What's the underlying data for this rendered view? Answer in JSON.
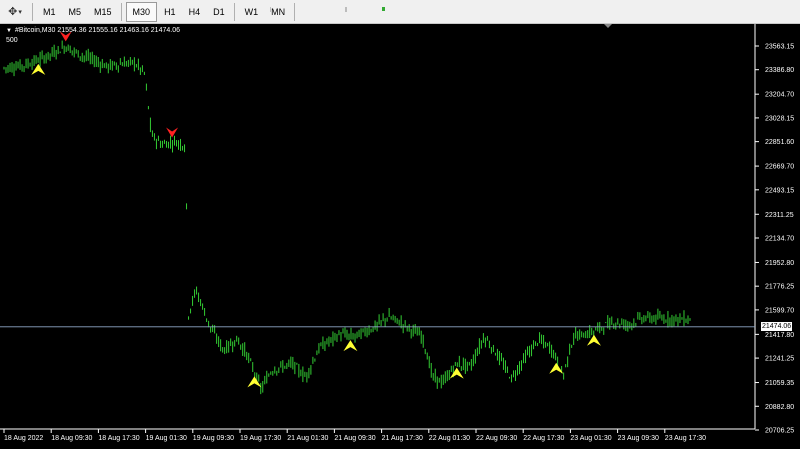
{
  "toolbar": {
    "timeframes": [
      {
        "label": "M1",
        "active": false
      },
      {
        "label": "M5",
        "active": false
      },
      {
        "label": "M15",
        "active": false
      },
      {
        "label": "M30",
        "active": true
      },
      {
        "label": "H1",
        "active": false
      },
      {
        "label": "H4",
        "active": false
      },
      {
        "label": "D1",
        "active": false
      },
      {
        "label": "W1",
        "active": false
      },
      {
        "label": "MN",
        "active": false
      }
    ]
  },
  "chart": {
    "header": "#Bitcoin,M30  21554.36 21555.16 21463.16 21474.06",
    "sub_label": "500",
    "current_price": "21474.06",
    "colors": {
      "background": "#000000",
      "candle": "#33cc33",
      "axis": "#ffffff",
      "price_line": "#8fa8c8",
      "buy_arrow": "#ffff33",
      "sell_arrow": "#ff2222"
    }
  },
  "chart_data": {
    "type": "candlestick",
    "symbol": "#Bitcoin",
    "timeframe": "M30",
    "last_ohlc": {
      "open": 21554.36,
      "high": 21555.16,
      "low": 21463.16,
      "close": 21474.06
    },
    "y_ticks": [
      "23563.15",
      "23386.80",
      "23204.70",
      "23028.15",
      "22851.60",
      "22669.70",
      "22493.15",
      "22311.25",
      "22134.70",
      "21952.80",
      "21776.25",
      "21599.70",
      "21417.80",
      "21241.25",
      "21059.35",
      "20882.80",
      "20706.25"
    ],
    "ylim": [
      20706.25,
      23563.15
    ],
    "x_ticks": [
      "18 Aug 2022",
      "18 Aug 09:30",
      "18 Aug 17:30",
      "19 Aug 01:30",
      "19 Aug 09:30",
      "19 Aug 17:30",
      "21 Aug 01:30",
      "21 Aug 09:30",
      "21 Aug 17:30",
      "22 Aug 01:30",
      "22 Aug 09:30",
      "22 Aug 17:30",
      "23 Aug 01:30",
      "23 Aug 09:30",
      "23 Aug 17:30"
    ],
    "price_profile": [
      [
        0,
        23400
      ],
      [
        0.03,
        23420
      ],
      [
        0.06,
        23480
      ],
      [
        0.09,
        23560
      ],
      [
        0.11,
        23500
      ],
      [
        0.13,
        23460
      ],
      [
        0.15,
        23410
      ],
      [
        0.17,
        23430
      ],
      [
        0.19,
        23440
      ],
      [
        0.205,
        23360
      ],
      [
        0.215,
        22900
      ],
      [
        0.23,
        22830
      ],
      [
        0.25,
        22850
      ],
      [
        0.265,
        22820
      ],
      [
        0.268,
        21550
      ],
      [
        0.28,
        21750
      ],
      [
        0.3,
        21480
      ],
      [
        0.32,
        21300
      ],
      [
        0.34,
        21380
      ],
      [
        0.355,
        21260
      ],
      [
        0.375,
        21010
      ],
      [
        0.39,
        21150
      ],
      [
        0.42,
        21200
      ],
      [
        0.44,
        21100
      ],
      [
        0.46,
        21320
      ],
      [
        0.49,
        21420
      ],
      [
        0.51,
        21400
      ],
      [
        0.54,
        21470
      ],
      [
        0.56,
        21550
      ],
      [
        0.58,
        21500
      ],
      [
        0.61,
        21400
      ],
      [
        0.625,
        21100
      ],
      [
        0.64,
        21060
      ],
      [
        0.66,
        21200
      ],
      [
        0.68,
        21180
      ],
      [
        0.7,
        21400
      ],
      [
        0.72,
        21260
      ],
      [
        0.74,
        21090
      ],
      [
        0.76,
        21250
      ],
      [
        0.78,
        21380
      ],
      [
        0.8,
        21300
      ],
      [
        0.815,
        21110
      ],
      [
        0.83,
        21400
      ],
      [
        0.85,
        21420
      ],
      [
        0.87,
        21470
      ],
      [
        0.89,
        21510
      ],
      [
        0.91,
        21490
      ],
      [
        0.93,
        21540
      ],
      [
        1.0,
        21530
      ]
    ],
    "buy_arrows": [
      0.05,
      0.365,
      0.505,
      0.66,
      0.805,
      0.86
    ],
    "sell_arrows": [
      0.09,
      0.245
    ]
  }
}
